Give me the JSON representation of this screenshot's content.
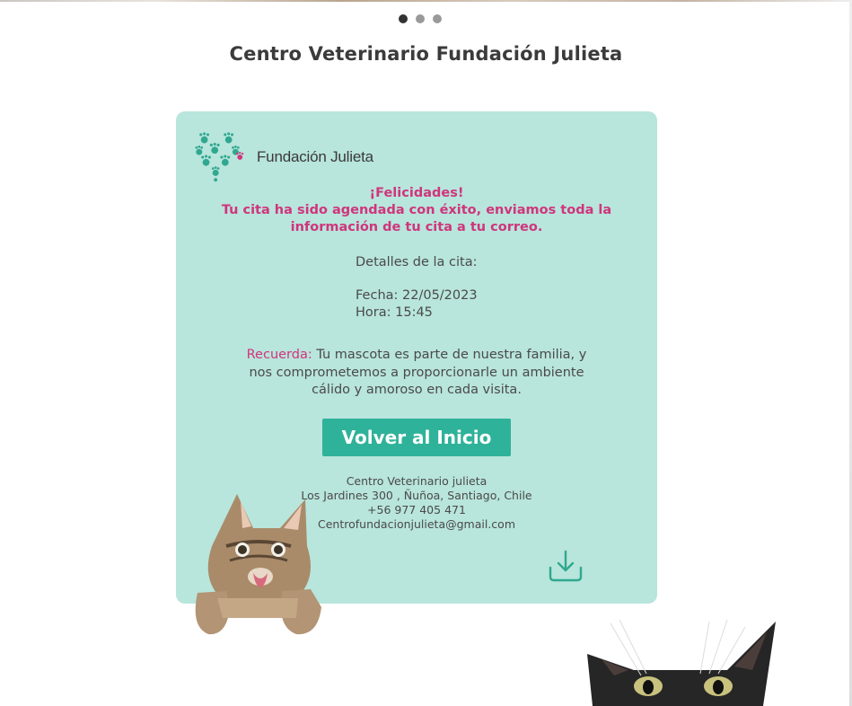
{
  "carousel": {
    "dots": 3,
    "active_index": 0
  },
  "page": {
    "title": "Centro Veterinario Fundación Julieta"
  },
  "card": {
    "logo_text": "Fundación Julieta",
    "congrats_line1": "¡Felicidades!",
    "congrats_line2": "Tu cita ha sido agendada con éxito, enviamos toda la",
    "congrats_line3": "información de tu cita a tu correo.",
    "details_heading": "Detalles de la cita:",
    "date_line": "Fecha: 22/05/2023",
    "time_line": "Hora: 15:45",
    "remember_label": "Recuerda:",
    "remember_text1": " Tu mascota es parte de nuestra familia, y",
    "remember_text2": "nos comprometemos a proporcionarle un ambiente",
    "remember_text3": "cálido y amoroso en cada visita.",
    "home_button": "Volver al Inicio",
    "contact": {
      "name": "Centro Veterinario julieta",
      "address": "Los Jardines 300 , Ñuñoa, Santiago, Chile",
      "phone": "+56 977 405 471",
      "email": "Centrofundacionjulieta@gmail.com"
    },
    "download_icon": "download-icon"
  },
  "colors": {
    "card_bg": "#b8e5dc",
    "accent_pink": "#d0357c",
    "button_green": "#2fb29a",
    "text": "#4a4a4a"
  }
}
